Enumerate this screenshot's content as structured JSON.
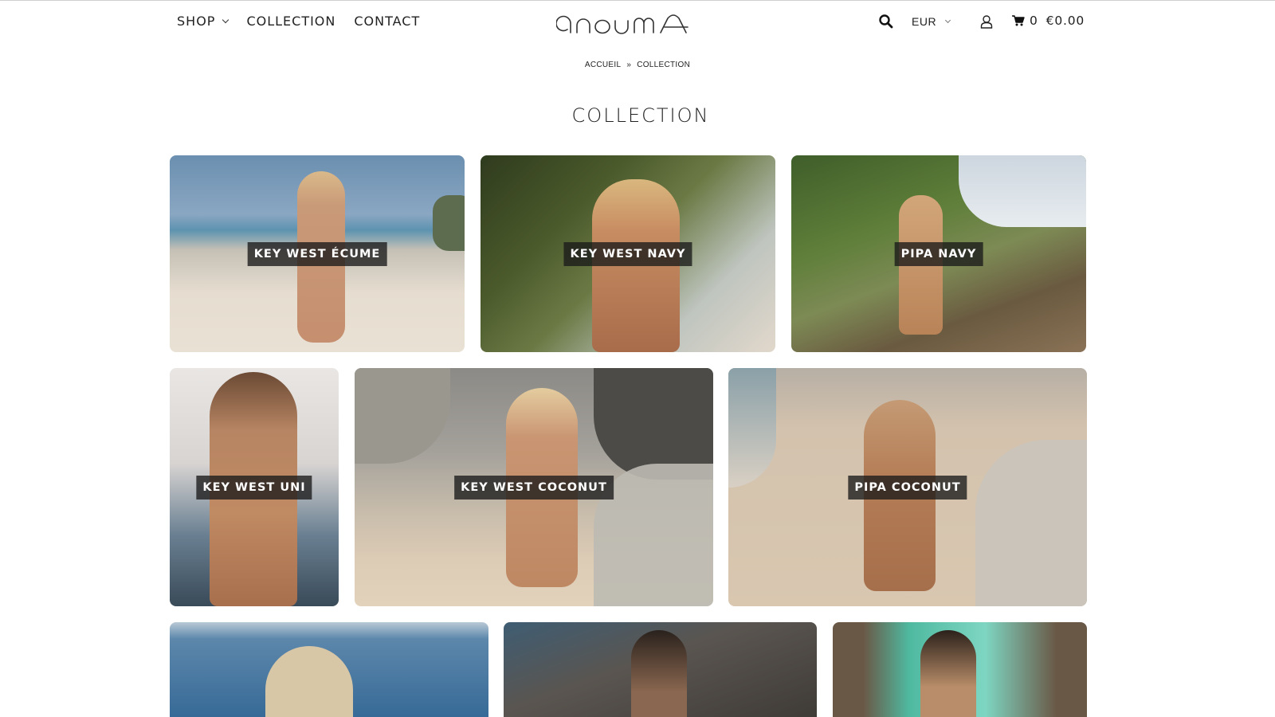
{
  "header": {
    "nav": [
      {
        "label": "SHOP",
        "has_dropdown": true
      },
      {
        "label": "COLLECTION"
      },
      {
        "label": "CONTACT"
      }
    ],
    "logo_text": "onouma",
    "currency": "EUR",
    "cart_count": "0",
    "cart_total": "€0.00",
    "icons": [
      "search-icon",
      "chevron-down-icon",
      "account-icon",
      "cart-icon"
    ]
  },
  "breadcrumb": {
    "home": "ACCUEIL",
    "separator": "»",
    "current": "COLLECTION"
  },
  "page_title": "COLLECTION",
  "collections": [
    {
      "label": "KEY WEST ÉCUME"
    },
    {
      "label": "KEY WEST NAVY"
    },
    {
      "label": "PIPA NAVY"
    },
    {
      "label": "KEY WEST UNI"
    },
    {
      "label": "KEY WEST COCONUT"
    },
    {
      "label": "PIPA COCONUT"
    }
  ],
  "colors": {
    "text": "#222222",
    "label_bg": "#191919",
    "label_text": "#ffffff"
  }
}
